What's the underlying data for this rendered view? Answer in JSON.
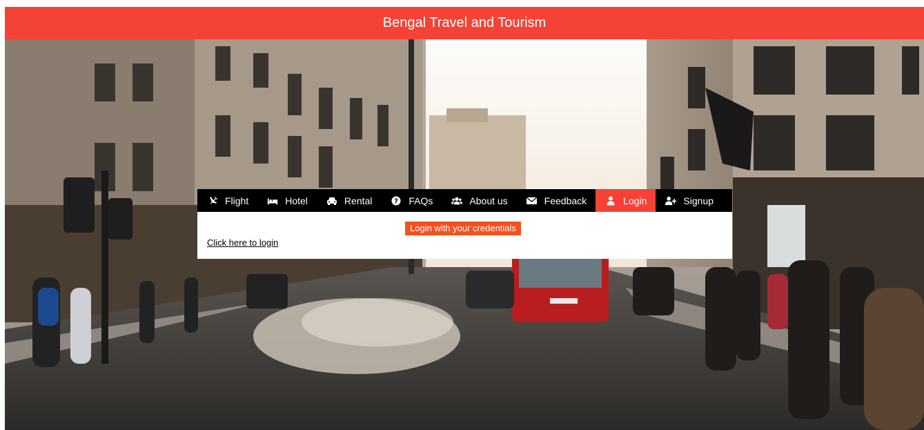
{
  "header": {
    "title": "Bengal Travel and Tourism"
  },
  "nav": {
    "items": [
      {
        "label": "Flight",
        "icon": "plane-icon"
      },
      {
        "label": "Hotel",
        "icon": "bed-icon"
      },
      {
        "label": "Rental",
        "icon": "car-icon"
      },
      {
        "label": "FAQs",
        "icon": "question-circle-icon"
      },
      {
        "label": "About us",
        "icon": "users-icon"
      },
      {
        "label": "Feedback",
        "icon": "envelope-icon"
      },
      {
        "label": "Login",
        "icon": "user-icon",
        "active": true
      },
      {
        "label": "Signup",
        "icon": "user-plus-icon"
      }
    ]
  },
  "login_panel": {
    "notice": "Login with your credentials",
    "link": "Click here to login"
  },
  "colors": {
    "accent": "#f44336",
    "notice": "#f4511e",
    "navbar": "#000000"
  }
}
